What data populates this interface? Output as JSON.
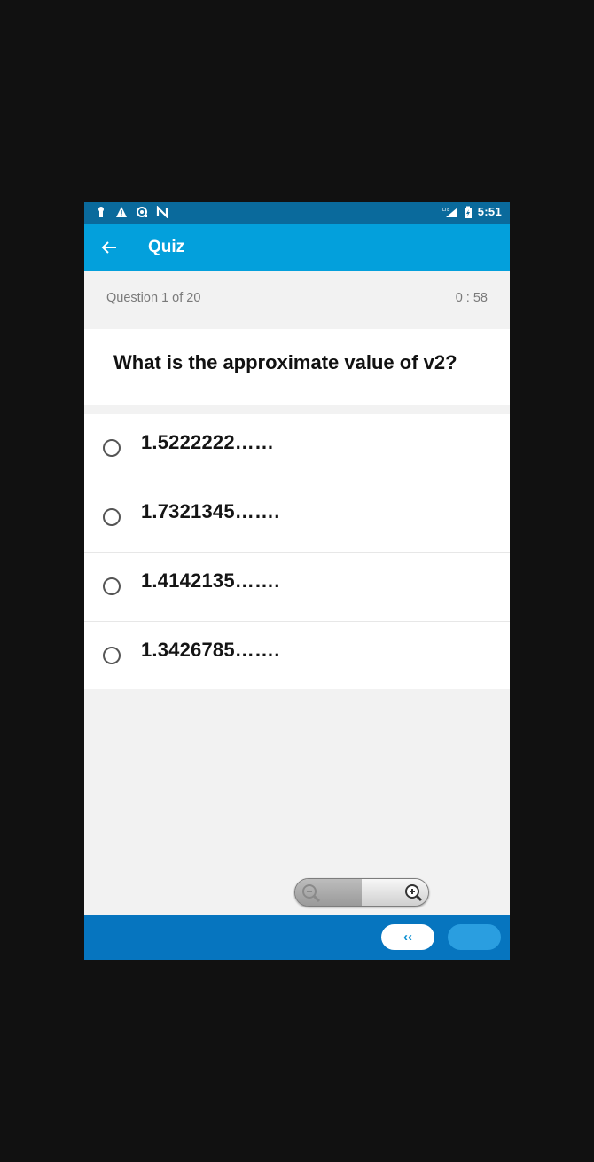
{
  "status_bar": {
    "time": "5:51",
    "left_icons": [
      "keyhole-icon",
      "warning-icon",
      "sync-icon",
      "n-icon"
    ],
    "right_icons": [
      "lte-signal-icon",
      "battery-charging-icon"
    ]
  },
  "app_bar": {
    "title": "Quiz",
    "back_icon": "arrow-left-icon"
  },
  "question_header": {
    "count": "Question 1 of  20",
    "timer": "0 : 58"
  },
  "question": {
    "text": "What is the approximate value of v2?"
  },
  "options": [
    {
      "label": "1.5222222……",
      "selected": false
    },
    {
      "label": "1.7321345…….",
      "selected": false
    },
    {
      "label": "1.4142135…….",
      "selected": false
    },
    {
      "label": "1.3426785…….",
      "selected": false
    }
  ],
  "zoom_control": {
    "out_icon": "zoom-out-icon",
    "in_icon": "zoom-in-icon"
  },
  "bottom_bar": {
    "prev_label": "‹‹",
    "next_label": ""
  },
  "colors": {
    "status_bar": "#0a6a9c",
    "app_bar": "#03a0dc",
    "bottom_bar": "#0675bf",
    "background": "#f2f2f2"
  }
}
